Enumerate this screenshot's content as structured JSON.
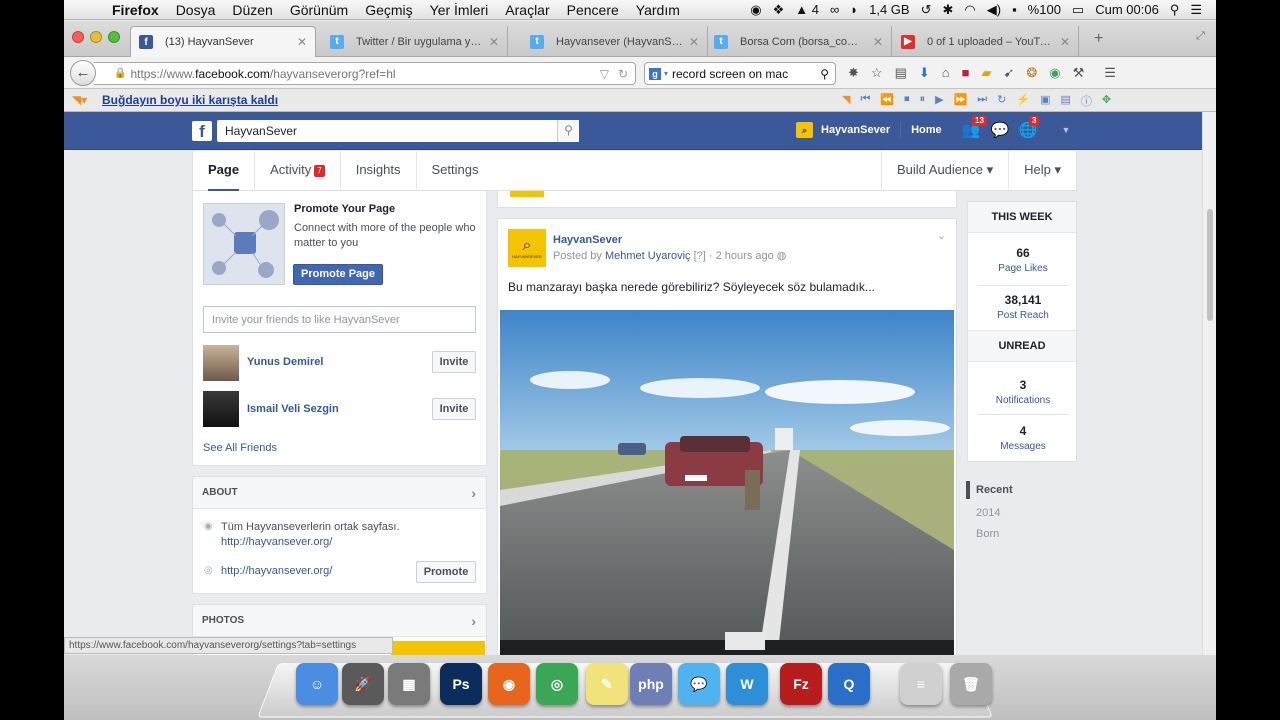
{
  "menubar": {
    "app": "Firefox",
    "menus": [
      "Dosya",
      "Düzen",
      "Görünüm",
      "Geçmiş",
      "Yer İmleri",
      "Araçlar",
      "Pencere",
      "Yardım"
    ],
    "status_ai": "4",
    "memory": "1,4 GB",
    "battery": "%100",
    "clock": "Cum 00:06"
  },
  "tabs": [
    {
      "title": "(13) HayvanSever",
      "icon": "facebook-icon",
      "color": "#3b5998",
      "glyph": "f"
    },
    {
      "title": "Twitter / Bir uygulama yet...",
      "icon": "twitter-icon",
      "color": "#55acee",
      "glyph": "t"
    },
    {
      "title": "Hayvansever (HayvanSever...",
      "icon": "twitter-icon",
      "color": "#55acee",
      "glyph": "t"
    },
    {
      "title": "Borsa Com (borsa_com) T...",
      "icon": "twitter-icon",
      "color": "#55acee",
      "glyph": "t"
    },
    {
      "title": "0 of 1 uploaded – YouTube",
      "icon": "youtube-icon",
      "color": "#e52d27",
      "glyph": "▶"
    }
  ],
  "url": {
    "scheme": "https://www.",
    "host": "facebook.com",
    "path": "/hayvanseverorg?ref=hl"
  },
  "search": {
    "value": "record screen on mac"
  },
  "bookmark": {
    "label": "Buğdayın boyu iki karışta kaldı"
  },
  "fb": {
    "search_value": "HayvanSever",
    "page_name": "HayvanSever",
    "home": "Home",
    "friends_count": "13",
    "notif_count": "3"
  },
  "pagenav": {
    "page": "Page",
    "activity": "Activity",
    "activity_badge": "7",
    "insights": "Insights",
    "settings": "Settings",
    "build": "Build Audience ▾",
    "help": "Help ▾"
  },
  "promote": {
    "title": "Promote Your Page",
    "desc": "Connect with more of the people who matter to you",
    "button": "Promote Page",
    "invite_placeholder": "Invite your friends to like HayvanSever"
  },
  "friends": [
    {
      "name": "Yunus Demirel",
      "button": "Invite"
    },
    {
      "name": "Ismail Veli Sezgin",
      "button": "Invite"
    }
  ],
  "see_all": "See All Friends",
  "about": {
    "title": "ABOUT",
    "desc": "Tüm Hayvanseverlerin ortak sayfası.",
    "link1": "http://hayvansever.org/",
    "link2": "http://hayvansever.org/",
    "promote": "Promote"
  },
  "photos": {
    "title": "PHOTOS"
  },
  "post": {
    "page": "HayvanSever",
    "posted_by": "Posted by",
    "author": "Mehmet Uyaroviç",
    "meta": "[?] · 2 hours ago",
    "text": "Bu manzarayı başka nerede görebiliriz? Söyleyecek söz bulamadık...",
    "logo_caption": "HAYVANSEVER"
  },
  "stats": {
    "this_week": "THIS WEEK",
    "likes_n": "66",
    "likes_l": "Page Likes",
    "reach_n": "38,141",
    "reach_l": "Post Reach",
    "unread": "UNREAD",
    "notif_n": "3",
    "notif_l": "Notifications",
    "msg_n": "4",
    "msg_l": "Messages"
  },
  "timeline": [
    "Recent",
    "2014",
    "Born"
  ],
  "statusbar": "https://www.facebook.com/hayvanseverorg/settings?tab=settings",
  "dock": [
    {
      "name": "finder",
      "color": "#4b8de0",
      "glyph": "☺"
    },
    {
      "name": "launchpad",
      "color": "#5a5a5a",
      "glyph": "🚀"
    },
    {
      "name": "image-capture",
      "color": "#7a7a7a",
      "glyph": "▦"
    },
    {
      "name": "photoshop",
      "color": "#0b2c5c",
      "glyph": "Ps"
    },
    {
      "name": "firefox",
      "color": "#e8651c",
      "glyph": "◉"
    },
    {
      "name": "chrome",
      "color": "#3aa757",
      "glyph": "◎"
    },
    {
      "name": "stickies",
      "color": "#f2e27a",
      "glyph": "✎"
    },
    {
      "name": "php",
      "color": "#6f7fb6",
      "glyph": "php"
    },
    {
      "name": "messages",
      "color": "#4fb3f0",
      "glyph": "💬"
    },
    {
      "name": "coda",
      "color": "#2d8fd8",
      "glyph": "W"
    },
    {
      "name": "filezilla",
      "color": "#b81d1d",
      "glyph": "Fz"
    },
    {
      "name": "quicktime",
      "color": "#2a6fc7",
      "glyph": "Q"
    },
    {
      "name": "filezilla-doc",
      "color": "#d0d0d0",
      "glyph": "≡"
    },
    {
      "name": "trash",
      "color": "#a9a9a9",
      "glyph": "🗑"
    }
  ]
}
